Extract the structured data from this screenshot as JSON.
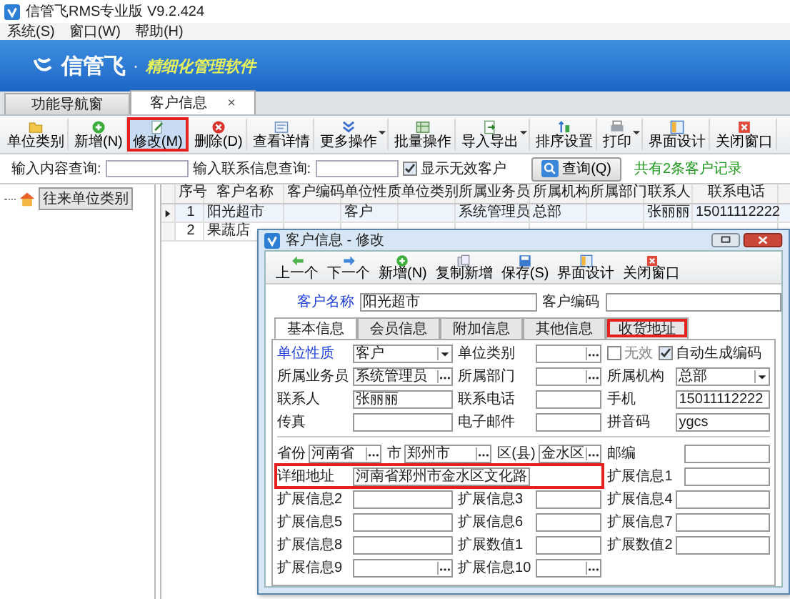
{
  "window": {
    "title": "信管飞RMS专业版 V9.2.424"
  },
  "menu": [
    "系统(S)",
    "窗口(W)",
    "帮助(H)"
  ],
  "banner": {
    "brand": "信管飞",
    "separator": "·",
    "slogan": "精细化管理软件"
  },
  "tabs": [
    {
      "label": "功能导航窗",
      "selected": false
    },
    {
      "label": "客户信息",
      "selected": true,
      "close": "×"
    }
  ],
  "toolbar": [
    {
      "label": "单位类别",
      "highlighted": false,
      "has_menu": false
    },
    {
      "label": "新增(N)",
      "highlighted": false,
      "has_menu": false
    },
    {
      "label": "修改(M)",
      "highlighted": true,
      "has_menu": false
    },
    {
      "label": "删除(D)",
      "highlighted": false,
      "has_menu": false
    },
    {
      "label": "查看详情",
      "highlighted": false,
      "has_menu": false
    },
    {
      "label": "更多操作",
      "highlighted": false,
      "has_menu": true
    },
    {
      "label": "批量操作",
      "highlighted": false,
      "has_menu": false
    },
    {
      "label": "导入导出",
      "highlighted": false,
      "has_menu": true
    },
    {
      "label": "排序设置",
      "highlighted": false,
      "has_menu": false
    },
    {
      "label": "打印",
      "highlighted": false,
      "has_menu": true
    },
    {
      "label": "界面设计",
      "highlighted": false,
      "has_menu": false
    },
    {
      "label": "关闭窗口",
      "highlighted": false,
      "has_menu": false
    }
  ],
  "search": {
    "content_label": "输入内容查询:",
    "contact_label": "输入联系信息查询:",
    "show_invalid": {
      "label": "显示无效客户",
      "checked": true
    },
    "button": "查询(Q)",
    "summary": "共有2条客户记录"
  },
  "tree": {
    "items": [
      {
        "label": "往来单位类别",
        "selected": true
      }
    ]
  },
  "table": {
    "columns": [
      "序号",
      "客户名称",
      "客户编码",
      "单位性质",
      "单位类别",
      "所属业务员",
      "所属机构",
      "所属部门",
      "联系人",
      "联系电话"
    ],
    "rows": [
      {
        "current": true,
        "cells": [
          "1",
          "阳光超市",
          null,
          "客户",
          null,
          "系统管理员",
          "总部",
          null,
          "张丽丽",
          "15011112222"
        ]
      },
      {
        "current": false,
        "cells": [
          "2",
          "果蔬店",
          null,
          null,
          null,
          null,
          null,
          null,
          null,
          null
        ]
      }
    ]
  },
  "dialog": {
    "title": "客户信息 - 修改",
    "toolbar": [
      "上一个",
      "下一个",
      "新增(N)",
      "复制新增",
      "保存(S)",
      "界面设计",
      "关闭窗口"
    ],
    "name": {
      "label": "客户名称",
      "value": "阳光超市"
    },
    "code": {
      "label": "客户编码"
    },
    "tabs": [
      {
        "label": "基本信息",
        "selected": true,
        "highlighted": false
      },
      {
        "label": "会员信息",
        "selected": false,
        "highlighted": false
      },
      {
        "label": "附加信息",
        "selected": false,
        "highlighted": false
      },
      {
        "label": "其他信息",
        "selected": false,
        "highlighted": false
      },
      {
        "label": "收货地址",
        "selected": false,
        "highlighted": true
      }
    ],
    "rows": [
      {
        "cells": [
          {
            "kind": "combo",
            "label": "单位性质",
            "value": "客户",
            "required": true
          },
          {
            "kind": "lookup",
            "label": "单位类别",
            "required": false
          },
          {
            "kind": "checkbox",
            "label": "无效",
            "checked": false
          },
          {
            "kind": "checkbox",
            "label": "自动生成编码",
            "checked": true
          }
        ]
      },
      {
        "cells": [
          {
            "kind": "lookup",
            "label": "所属业务员",
            "value": "系统管理员",
            "required": false
          },
          {
            "kind": "lookup",
            "label": "所属部门",
            "required": false
          },
          {
            "kind": "combo",
            "label": "所属机构",
            "value": "总部",
            "required": false
          }
        ]
      },
      {
        "cells": [
          {
            "kind": "text",
            "label": "联系人",
            "value": "张丽丽",
            "required": false
          },
          {
            "kind": "text",
            "label": "联系电话",
            "required": false
          },
          {
            "kind": "text",
            "label": "手机",
            "value": "15011112222",
            "required": false
          }
        ]
      },
      {
        "cells": [
          {
            "kind": "text",
            "label": "传真",
            "required": false
          },
          {
            "kind": "text",
            "label": "电子邮件",
            "required": false
          },
          {
            "kind": "text",
            "label": "拼音码",
            "value": "ygcs",
            "required": false
          }
        ]
      }
    ],
    "address": {
      "province": {
        "label": "省份",
        "value": "河南省"
      },
      "city": {
        "label": "市",
        "value": "郑州市"
      },
      "district": {
        "label": "区(县)",
        "value": "金水区"
      },
      "postcode": {
        "label": "邮编"
      }
    },
    "detail": {
      "highlighted": true,
      "address": {
        "label": "详细地址",
        "value": "河南省郑州市金水区文化路"
      },
      "extra": {
        "label": "扩展信息1"
      }
    },
    "extra_rows": [
      {
        "cells": [
          {
            "kind": "text",
            "label": "扩展信息2",
            "required": false
          },
          {
            "kind": "text",
            "label": "扩展信息3",
            "required": false
          },
          {
            "kind": "text",
            "label": "扩展信息4",
            "required": false
          }
        ]
      },
      {
        "cells": [
          {
            "kind": "text",
            "label": "扩展信息5",
            "required": false
          },
          {
            "kind": "text",
            "label": "扩展信息6",
            "required": false
          },
          {
            "kind": "text",
            "label": "扩展信息7",
            "required": false
          }
        ]
      },
      {
        "cells": [
          {
            "kind": "text",
            "label": "扩展信息8",
            "required": false
          },
          {
            "kind": "text",
            "label": "扩展数值1",
            "required": false
          },
          {
            "kind": "text",
            "label": "扩展数值2",
            "required": false
          }
        ]
      },
      {
        "cells": [
          {
            "kind": "lookup",
            "label": "扩展信息9",
            "required": false
          },
          {
            "kind": "lookup",
            "label": "扩展信息10",
            "required": false
          }
        ]
      }
    ]
  }
}
